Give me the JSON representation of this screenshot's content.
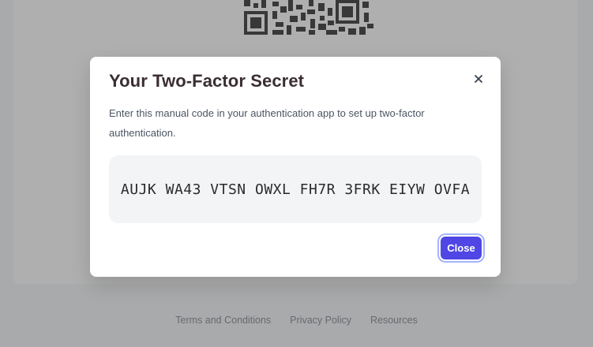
{
  "modal": {
    "title": "Your Two-Factor Secret",
    "description": "Enter this manual code in your authentication app to set up two-factor authentication.",
    "secret_code": "AUJK WA43 VTSN OWXL FH7R 3FRK EIYW OVFA",
    "close_button_label": "Close",
    "close_icon": "close-icon",
    "accent_color": "#4f46e5"
  },
  "footer": {
    "links": [
      "Terms and Conditions",
      "Privacy Policy",
      "Resources"
    ]
  },
  "background": {
    "qr_code_icon": "qr-code-icon"
  }
}
